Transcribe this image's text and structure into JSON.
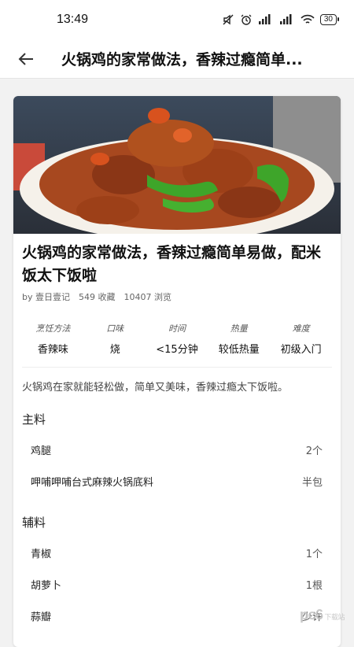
{
  "status": {
    "time": "13:49",
    "battery": "30"
  },
  "appbar": {
    "title": "火锅鸡的家常做法，香辣过瘾简单..."
  },
  "recipe": {
    "title": "火锅鸡的家常做法，香辣过瘾简单易做，配米饭太下饭啦",
    "author": "by 壹日壹记",
    "favorites": "549 收藏",
    "views": "10407 浏览",
    "attributes": [
      {
        "label": "烹饪方法",
        "value": "香辣味"
      },
      {
        "label": "口味",
        "value": "烧"
      },
      {
        "label": "时间",
        "value": "<15分钟"
      },
      {
        "label": "热量",
        "value": "较低热量"
      },
      {
        "label": "难度",
        "value": "初级入门"
      }
    ],
    "description": "火锅鸡在家就能轻松做，简单又美味，香辣过瘾太下饭啦。"
  },
  "main_ingredients": {
    "title": "主料",
    "items": [
      {
        "name": "鸡腿",
        "qty": "2个"
      },
      {
        "name": "呷哺呷哺台式麻辣火锅底料",
        "qty": "半包"
      }
    ]
  },
  "aux_ingredients": {
    "title": "辅料",
    "items": [
      {
        "name": "青椒",
        "qty": "1个"
      },
      {
        "name": "胡萝卜",
        "qty": "1根"
      },
      {
        "name": "蒜瓣",
        "qty": "少许"
      }
    ]
  },
  "watermark": {
    "brand": "pc6",
    "sub": "下载站"
  }
}
